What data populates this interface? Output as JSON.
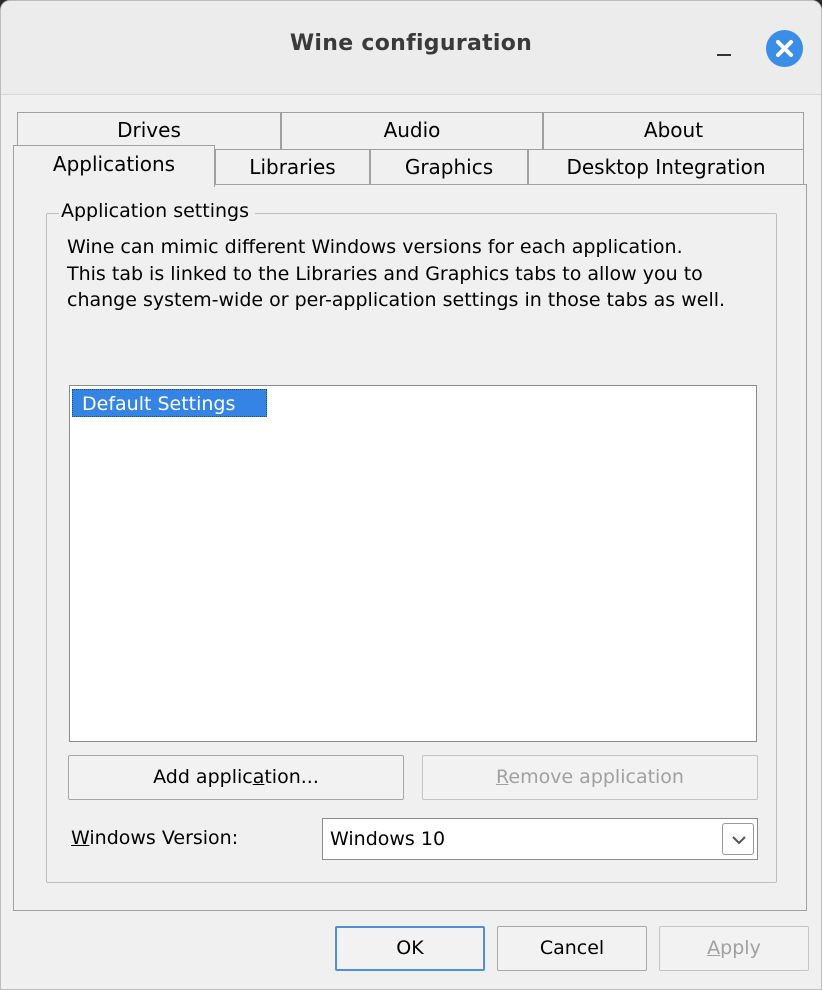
{
  "window": {
    "title": "Wine configuration"
  },
  "tabs": {
    "row1": [
      "Drives",
      "Audio",
      "About"
    ],
    "row2": [
      "Applications",
      "Libraries",
      "Graphics",
      "Desktop Integration"
    ],
    "active": "Applications"
  },
  "app_settings": {
    "group_title": "Application settings",
    "description": "Wine can mimic different Windows versions for each application. This tab is linked to the Libraries and Graphics tabs to allow you to change system-wide or per-application settings in those tabs as well.",
    "list_items": [
      "Default Settings"
    ],
    "add_button": {
      "pre": "Add applic",
      "accel": "a",
      "post": "tion..."
    },
    "remove_button": {
      "pre": "",
      "accel": "R",
      "post": "emove application"
    },
    "windows_version": {
      "label_accel": "W",
      "label_rest": "indows Version:",
      "value": "Windows 10"
    }
  },
  "footer": {
    "ok": "OK",
    "cancel": "Cancel",
    "apply_accel": "A",
    "apply_rest": "pply"
  },
  "colors": {
    "selection": "#3584e4",
    "close_button": "#3b8ee8"
  },
  "icons": {
    "close": "close-icon",
    "minimize": "minimize-icon",
    "dropdown": "chevron-down-icon"
  }
}
